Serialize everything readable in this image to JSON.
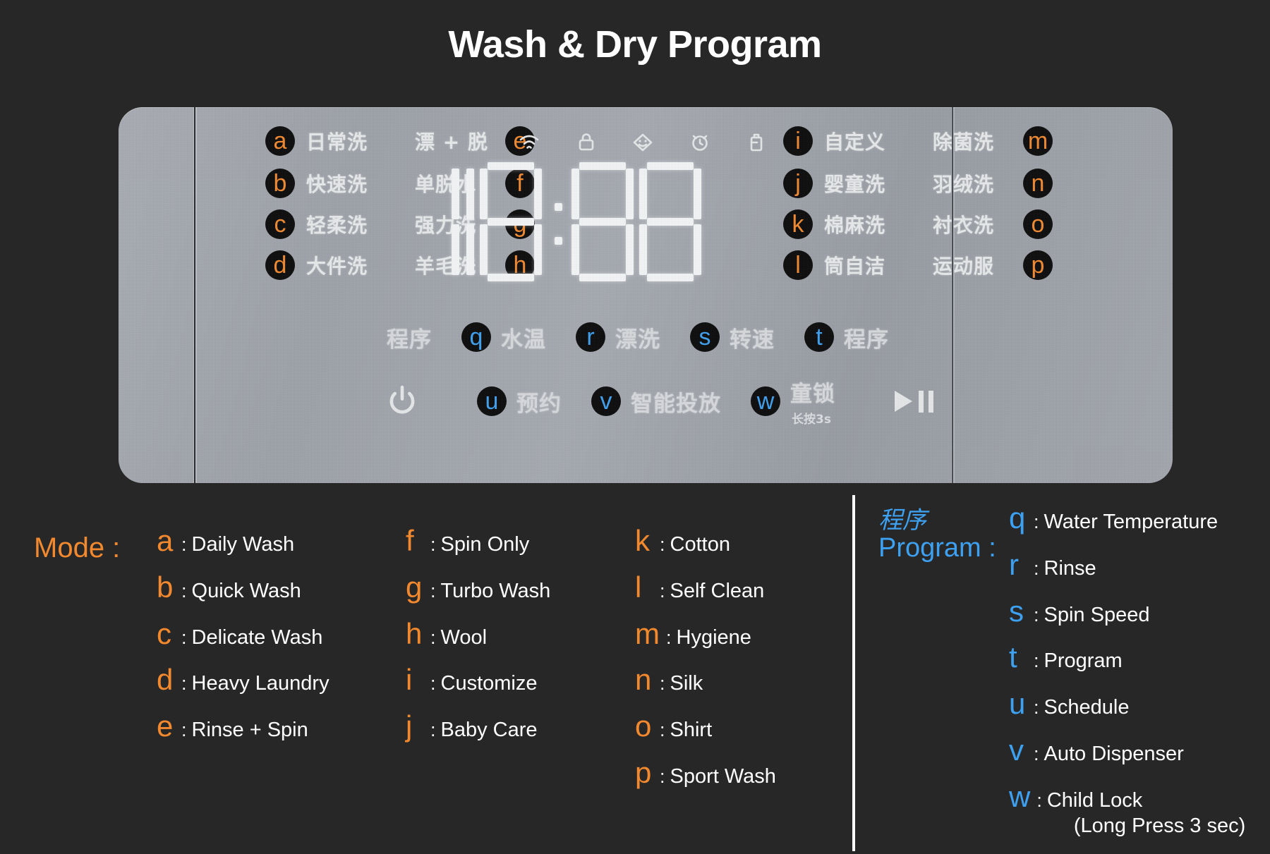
{
  "title": "Wash & Dry Program",
  "panel": {
    "display": {
      "value": "18:88",
      "digits": [
        "1",
        "8",
        "8",
        "8"
      ],
      "colon": ":"
    },
    "status_icons": [
      {
        "name": "wifi-icon",
        "label": "wifi"
      },
      {
        "name": "door-lock-icon",
        "label": "lock"
      },
      {
        "name": "drum-light-icon",
        "label": "drum light"
      },
      {
        "name": "alarm-clock-icon",
        "label": "alarm"
      },
      {
        "name": "detergent-bottle-icon",
        "label": "detergent"
      }
    ],
    "mode_rows": [
      {
        "key_left": "a",
        "label_left": "日常洗",
        "label_right": "漂 + 脱",
        "key_right": "e"
      },
      {
        "key_left": "b",
        "label_left": "快速洗",
        "label_right": "单脱水",
        "key_right": "f"
      },
      {
        "key_left": "c",
        "label_left": "轻柔洗",
        "label_right": "强力洗",
        "key_right": "g"
      },
      {
        "key_left": "d",
        "label_left": "大件洗",
        "label_right": "羊毛洗",
        "key_right": "h"
      }
    ],
    "mode_rows_right": [
      {
        "key_left": "i",
        "label_left": "自定义",
        "label_right": "除菌洗",
        "key_right": "m"
      },
      {
        "key_left": "j",
        "label_left": "婴童洗",
        "label_right": "羽绒洗",
        "key_right": "n"
      },
      {
        "key_left": "k",
        "label_left": "棉麻洗",
        "label_right": "衬衣洗",
        "key_right": "o"
      },
      {
        "key_left": "l",
        "label_left": "筒自洁",
        "label_right": "运动服",
        "key_right": "p"
      }
    ],
    "program_row": {
      "first_label": "程序",
      "items": [
        {
          "key": "q",
          "label": "水温"
        },
        {
          "key": "r",
          "label": "漂洗"
        },
        {
          "key": "s",
          "label": "转速"
        },
        {
          "key": "t",
          "label": "程序"
        }
      ]
    },
    "button_row": {
      "power_icon": "power-icon",
      "items": [
        {
          "key": "u",
          "label": "预约",
          "sub": ""
        },
        {
          "key": "v",
          "label": "智能投放",
          "sub": ""
        },
        {
          "key": "w",
          "label": "童锁",
          "sub": "长按3s"
        }
      ],
      "play_pause_icon": "play-pause-icon"
    }
  },
  "legend": {
    "mode_heading": "Mode :",
    "program_heading_zh": "程序",
    "program_heading_en": "Program :",
    "mode_col1": [
      {
        "key": "a",
        "sep": ":",
        "desc": "Daily Wash"
      },
      {
        "key": "b",
        "sep": ":",
        "desc": "Quick Wash"
      },
      {
        "key": "c",
        "sep": ":",
        "desc": "Delicate Wash"
      },
      {
        "key": "d",
        "sep": ":",
        "desc": "Heavy Laundry"
      },
      {
        "key": "e",
        "sep": ":",
        "desc": "Rinse + Spin"
      }
    ],
    "mode_col2": [
      {
        "key": "f",
        "sep": ":",
        "desc": "Spin Only"
      },
      {
        "key": "g",
        "sep": ":",
        "desc": "Turbo Wash"
      },
      {
        "key": "h",
        "sep": ":",
        "desc": "Wool"
      },
      {
        "key": "i",
        "sep": ":",
        "desc": "Customize"
      },
      {
        "key": "j",
        "sep": ":",
        "desc": "Baby Care"
      }
    ],
    "mode_col3": [
      {
        "key": "k",
        "sep": ":",
        "desc": "Cotton"
      },
      {
        "key": "l",
        "sep": ":",
        "desc": "Self Clean"
      },
      {
        "key": "m",
        "sep": ":",
        "desc": "Hygiene"
      },
      {
        "key": "n",
        "sep": ":",
        "desc": "Silk"
      },
      {
        "key": "o",
        "sep": ":",
        "desc": "Shirt"
      },
      {
        "key": "p",
        "sep": ":",
        "desc": "Sport Wash"
      }
    ],
    "program_col": [
      {
        "key": "q",
        "sep": ":",
        "desc": "Water Temperature"
      },
      {
        "key": "r",
        "sep": ":",
        "desc": "Rinse"
      },
      {
        "key": "s",
        "sep": ":",
        "desc": "Spin Speed"
      },
      {
        "key": "t",
        "sep": ":",
        "desc": "Program"
      },
      {
        "key": "u",
        "sep": ":",
        "desc": "Schedule"
      },
      {
        "key": "v",
        "sep": ":",
        "desc": "Auto Dispenser"
      },
      {
        "key": "w",
        "sep": ":",
        "desc": "Child Lock",
        "desc_line2": "(Long Press 3 sec)"
      }
    ]
  },
  "colors": {
    "background": "#272727",
    "accent_orange": "#f2892f",
    "accent_blue": "#3ea0f0",
    "panel_gray": "#a3a7ae",
    "text_white": "#ffffff",
    "segment_white": "#f4f6f7"
  }
}
